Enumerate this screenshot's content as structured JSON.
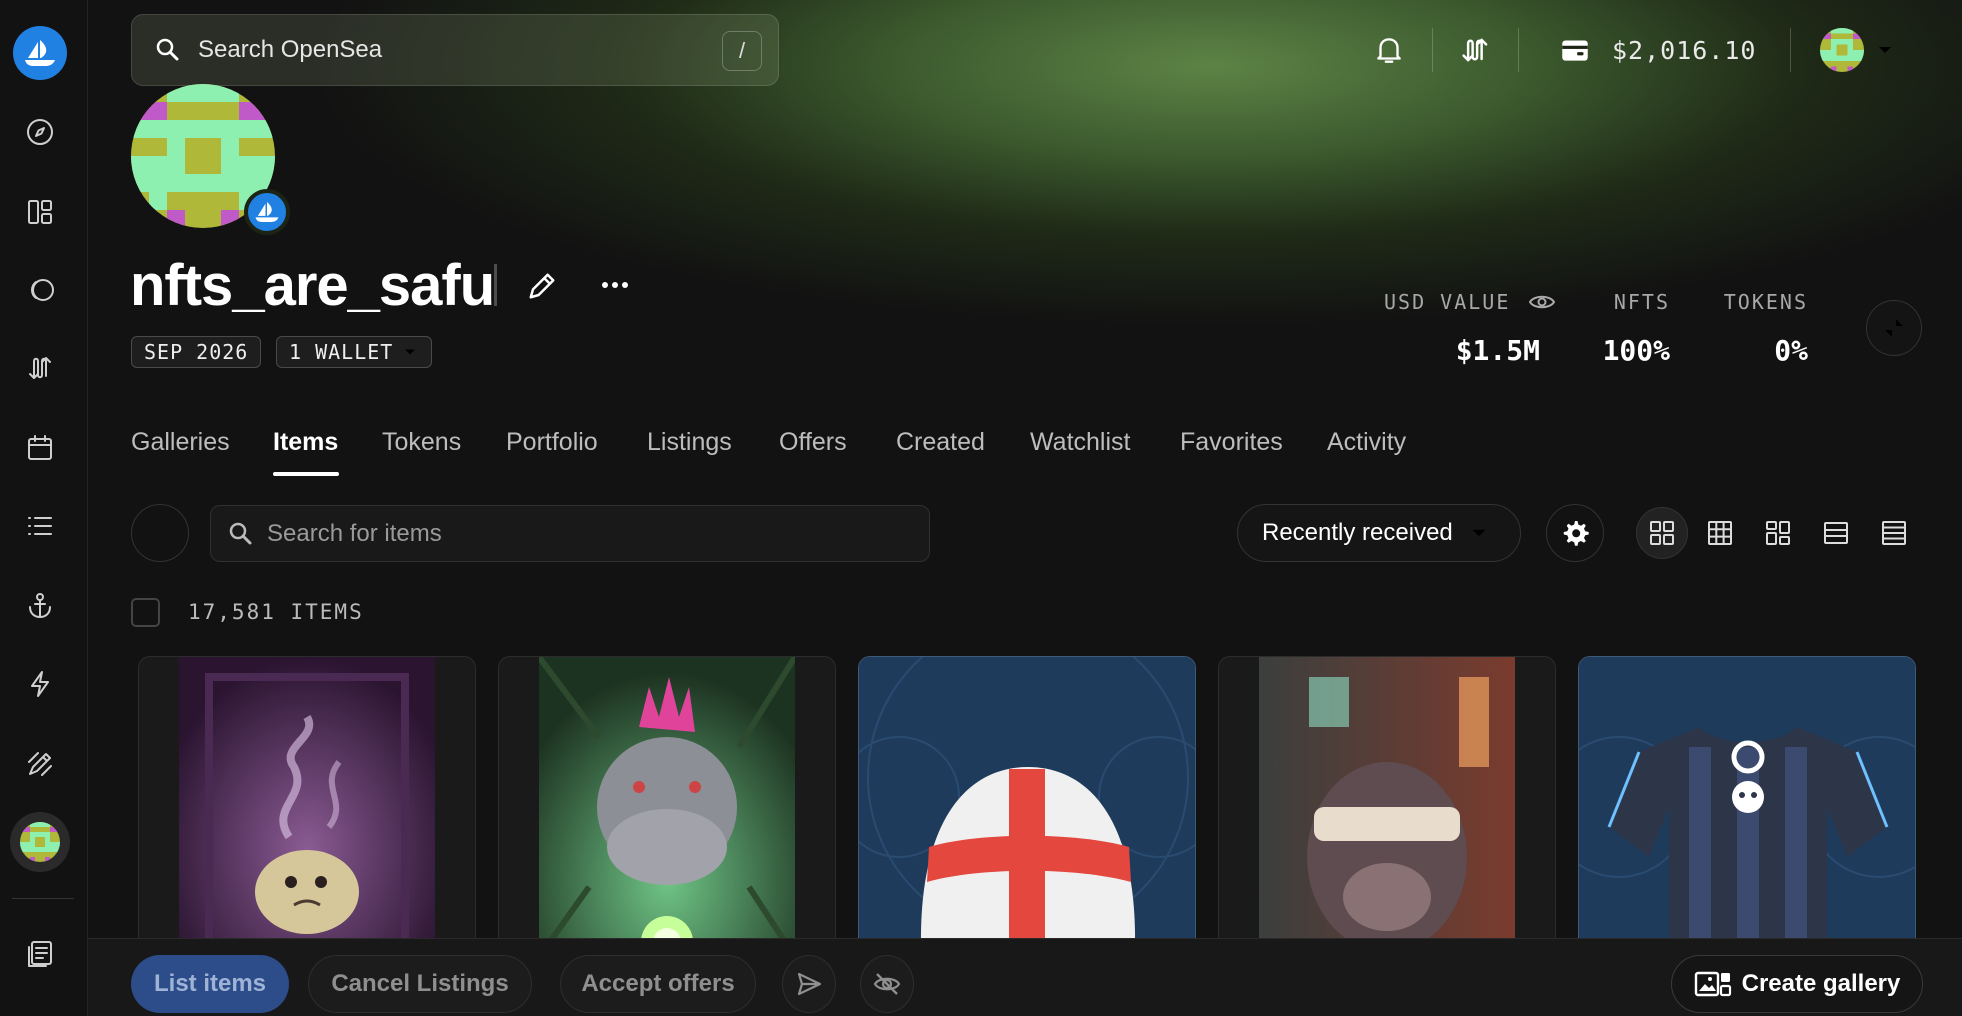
{
  "search": {
    "placeholder": "Search OpenSea",
    "shortcut": "/"
  },
  "header": {
    "balance": "$2,016.10"
  },
  "profile": {
    "username": "nfts_are_safu",
    "joined": "SEP 2026",
    "wallets": "1 WALLET"
  },
  "stats": {
    "usd_label": "USD VALUE",
    "usd_value": "$1.5M",
    "nfts_label": "NFTS",
    "nfts_value": "100%",
    "tokens_label": "TOKENS",
    "tokens_value": "0%"
  },
  "tabs": [
    "Galleries",
    "Items",
    "Tokens",
    "Portfolio",
    "Listings",
    "Offers",
    "Created",
    "Watchlist",
    "Favorites",
    "Activity"
  ],
  "active_tab": "Items",
  "toolbar": {
    "search_placeholder": "Search for items",
    "sort_label": "Recently received"
  },
  "items": {
    "count_label": "17,581 ITEMS"
  },
  "bottom_bar": {
    "list_items": "List items",
    "cancel_listings": "Cancel Listings",
    "accept_offers": "Accept offers",
    "create_gallery": "Create gallery"
  },
  "colors": {
    "accent": "#2081e2",
    "background": "#121212"
  }
}
